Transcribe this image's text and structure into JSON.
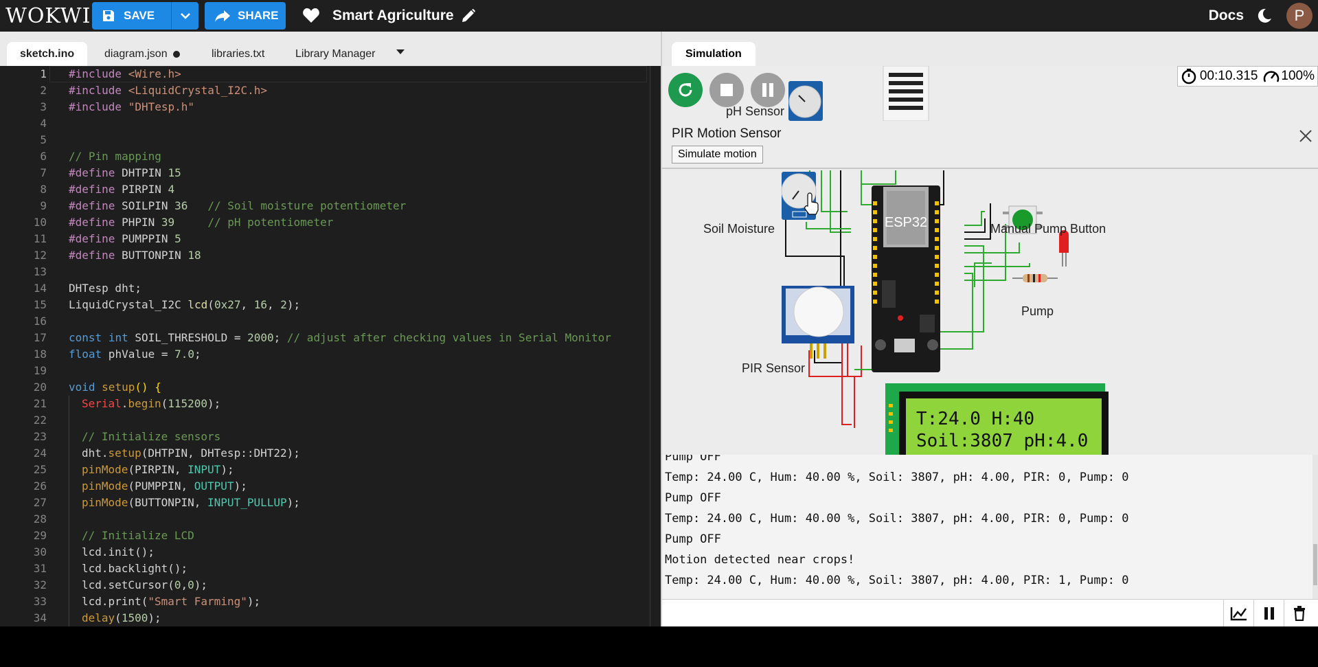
{
  "app": {
    "logo": "WOKWI",
    "save_label": "SAVE",
    "share_label": "SHARE",
    "project_title": "Smart Agriculture",
    "docs_label": "Docs",
    "avatar_initial": "P"
  },
  "editor": {
    "tabs": [
      {
        "label": "sketch.ino"
      },
      {
        "label": "diagram.json"
      },
      {
        "label": "libraries.txt"
      },
      {
        "label": "Library Manager"
      }
    ],
    "line_numbers": [
      "1",
      "2",
      "3",
      "4",
      "5",
      "6",
      "7",
      "8",
      "9",
      "10",
      "11",
      "12",
      "13",
      "14",
      "15",
      "16",
      "17",
      "18",
      "19",
      "20",
      "21",
      "22",
      "23",
      "24",
      "25",
      "26",
      "27",
      "28",
      "29",
      "30",
      "31",
      "32",
      "33",
      "34"
    ],
    "code_lines": [
      "#include <Wire.h>",
      "#include <LiquidCrystal_I2C.h>",
      "#include \"DHTesp.h\"",
      "",
      "",
      "// Pin mapping",
      "#define DHTPIN 15",
      "#define PIRPIN 4",
      "#define SOILPIN 36   // Soil moisture potentiometer",
      "#define PHPIN 39     // pH potentiometer",
      "#define PUMPPIN 5",
      "#define BUTTONPIN 18",
      "",
      "DHTesp dht;",
      "LiquidCrystal_I2C lcd(0x27, 16, 2);",
      "",
      "const int SOIL_THRESHOLD = 2000; // adjust after checking values in Serial Monitor",
      "float phValue = 7.0;",
      "",
      "void setup() {",
      "  Serial.begin(115200);",
      "",
      "  // Initialize sensors",
      "  dht.setup(DHTPIN, DHTesp::DHT22);",
      "  pinMode(PIRPIN, INPUT);",
      "  pinMode(PUMPPIN, OUTPUT);",
      "  pinMode(BUTTONPIN, INPUT_PULLUP);",
      "",
      "  // Initialize LCD",
      "  lcd.init();",
      "  lcd.backlight();",
      "  lcd.setCursor(0,0);",
      "  lcd.print(\"Smart Farming\");",
      "  delay(1500);"
    ]
  },
  "simulation": {
    "tab_label": "Simulation",
    "timer": "00:10.315",
    "speed": "100%",
    "pir_panel": {
      "title": "PIR Motion Sensor",
      "button_label": "Simulate motion"
    },
    "components": {
      "ph_sensor": "pH Sensor",
      "soil_moisture": "Soil Moisture",
      "manual_pump_button": "Manual Pump Button",
      "pump": "Pump",
      "pir_sensor": "PIR Sensor",
      "esp32": "ESP32",
      "lcd_line1": "T:24.0 H:40",
      "lcd_line2": "Soil:3807 pH:4.0"
    },
    "serial_output": [
      "Pump OFF",
      "Temp: 24.00 C, Hum: 40.00 %, Soil: 3807, pH: 4.00, PIR: 0, Pump: 0",
      "Pump OFF",
      "Temp: 24.00 C, Hum: 40.00 %, Soil: 3807, pH: 4.00, PIR: 0, Pump: 0",
      "Pump OFF",
      "Motion detected near crops!",
      "Temp: 24.00 C, Hum: 40.00 %, Soil: 3807, pH: 4.00, PIR: 1, Pump: 0"
    ],
    "serial_input_value": ""
  },
  "colors": {
    "topbar": "#1f1f1f",
    "accent_blue": "#1e88e5",
    "run_green": "#1e9a4f",
    "editor_bg": "#1e1e1e",
    "esp32_board": "#1a1a1a",
    "lcd_green": "#8fd43a"
  },
  "icons": [
    "save-icon",
    "chevron-down-icon",
    "share-icon",
    "heart-icon",
    "pencil-icon",
    "moon-icon",
    "restart-icon",
    "stop-icon",
    "pause-icon",
    "stopwatch-icon",
    "speedometer-icon",
    "close-icon",
    "chart-icon",
    "pause-serial-icon",
    "trash-icon"
  ]
}
